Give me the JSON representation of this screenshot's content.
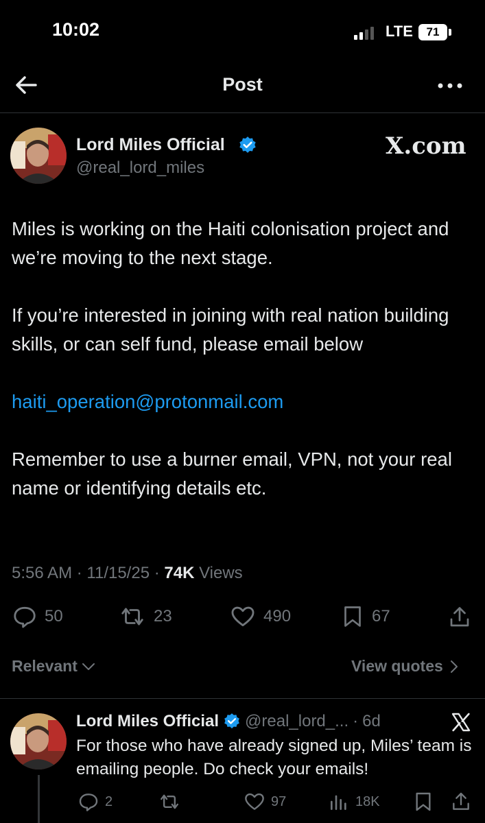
{
  "status_bar": {
    "time": "10:02",
    "network": "LTE",
    "battery": "71"
  },
  "header": {
    "title": "Post"
  },
  "post": {
    "author_name": "Lord Miles Official",
    "author_handle": "@real_lord_miles",
    "source": "X.com",
    "paragraphs": {
      "p1": "Miles is working on the Haiti colonisation project and we’re moving to the next stage.",
      "p2": "If you’re interested in joining with real nation building skills, or can self fund, please email below",
      "email": "haiti_operation@protonmail.com",
      "p3": "Remember to use a burner email, VPN, not your real name or identifying details etc."
    },
    "time": "5:56 AM",
    "date": "11/15/25",
    "views_count": "74K",
    "views_label": "Views",
    "stats": {
      "replies": "50",
      "reposts": "23",
      "likes": "490",
      "bookmarks": "67"
    }
  },
  "sort": {
    "relevant_label": "Relevant",
    "view_quotes_label": "View quotes"
  },
  "reply": {
    "author_name": "Lord Miles Official",
    "author_handle": "@real_lord_...",
    "age": "6d",
    "text": "For those who have already signed up, Miles’ team is emailing people. Do check your emails!",
    "stats": {
      "replies": "2",
      "likes": "97",
      "views": "18K"
    }
  },
  "colors": {
    "background": "#000000",
    "link": "#1d9bf0",
    "verified": "#1d9bf0",
    "muted": "#71767b",
    "text": "#e7e9ea"
  }
}
